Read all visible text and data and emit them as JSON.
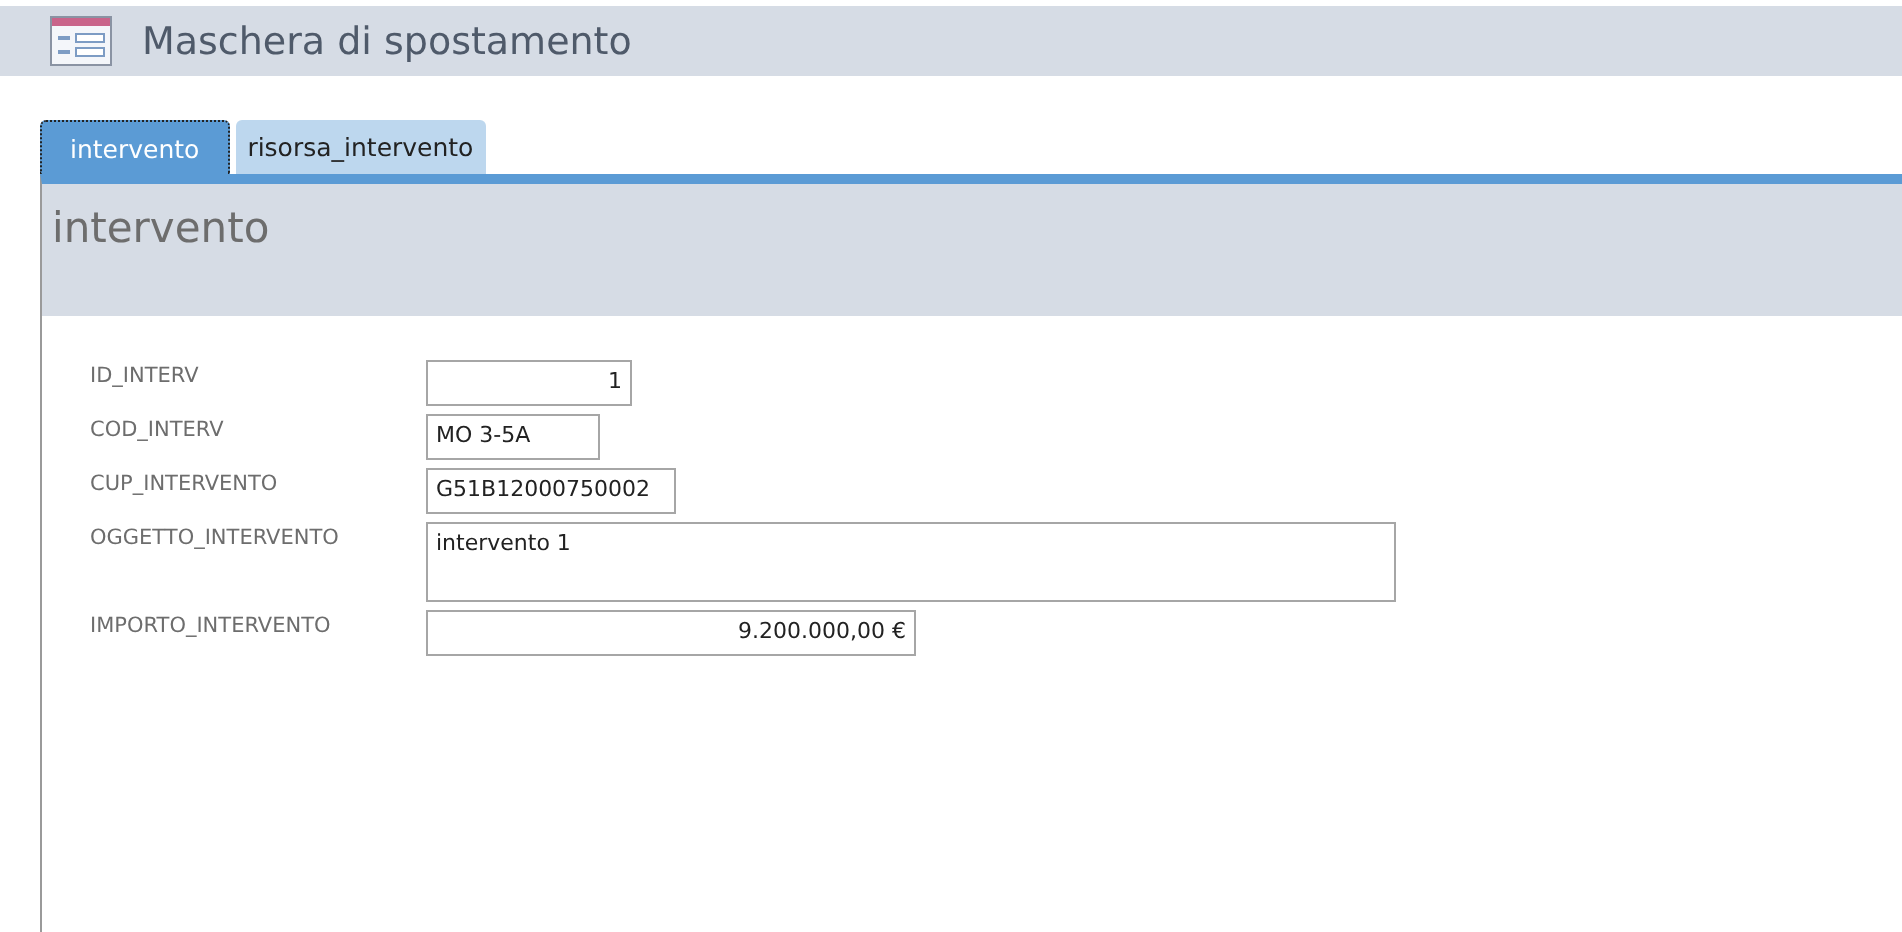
{
  "window": {
    "title": "Maschera di spostamento"
  },
  "tabs": [
    {
      "label": "intervento",
      "selected": true
    },
    {
      "label": "risorsa_intervento",
      "selected": false
    }
  ],
  "section": {
    "title": "intervento"
  },
  "fields": [
    {
      "label": "ID_INTERV",
      "value": "1",
      "kind": "number"
    },
    {
      "label": "COD_INTERV",
      "value": "MO 3-5A",
      "kind": "text"
    },
    {
      "label": "CUP_INTERVENTO",
      "value": "G51B12000750002",
      "kind": "text"
    },
    {
      "label": "OGGETTO_INTERVENTO",
      "value": "intervento 1",
      "kind": "memo"
    },
    {
      "label": "IMPORTO_INTERVENTO",
      "value": "9.200.000,00 €",
      "kind": "number"
    }
  ]
}
